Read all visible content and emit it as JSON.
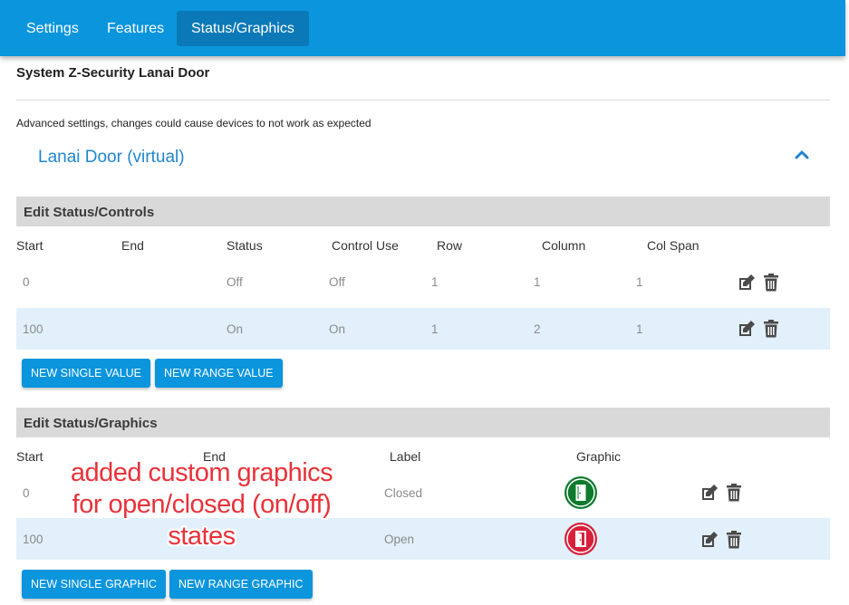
{
  "tabs": [
    {
      "label": "Settings",
      "active": false
    },
    {
      "label": "Features",
      "active": false
    },
    {
      "label": "Status/Graphics",
      "active": true
    }
  ],
  "system_title": "System Z-Security Lanai Door",
  "warning": "Advanced settings, changes could cause devices to not work as expected",
  "device_name": "Lanai Door (virtual)",
  "status_controls": {
    "title": "Edit Status/Controls",
    "headers": [
      "Start",
      "End",
      "Status",
      "Control Use",
      "Row",
      "Column",
      "Col Span"
    ],
    "rows": [
      {
        "start": "0",
        "end": "",
        "status": "Off",
        "control_use": "Off",
        "row": "1",
        "column": "1",
        "col_span": "1"
      },
      {
        "start": "100",
        "end": "",
        "status": "On",
        "control_use": "On",
        "row": "1",
        "column": "2",
        "col_span": "1"
      }
    ],
    "buttons": {
      "new_single": "NEW SINGLE VALUE",
      "new_range": "NEW RANGE VALUE"
    }
  },
  "status_graphics": {
    "title": "Edit Status/Graphics",
    "headers": [
      "Start",
      "End",
      "Label",
      "Graphic"
    ],
    "rows": [
      {
        "start": "0",
        "end": "",
        "label": "Closed",
        "graphic": "door-closed-icon",
        "color": "#0e7a2e"
      },
      {
        "start": "100",
        "end": "",
        "label": "Open",
        "graphic": "door-open-icon",
        "color": "#d8203a"
      }
    ],
    "buttons": {
      "new_single": "NEW SINGLE GRAPHIC",
      "new_range": "NEW RANGE GRAPHIC"
    }
  },
  "annotation": {
    "line1": "added custom graphics",
    "line2": "for open/closed (on/off)",
    "line3": "states"
  },
  "colors": {
    "accent": "#0a95dd",
    "link": "#1f86cf",
    "closed": "#0e7a2e",
    "open": "#d8203a"
  }
}
